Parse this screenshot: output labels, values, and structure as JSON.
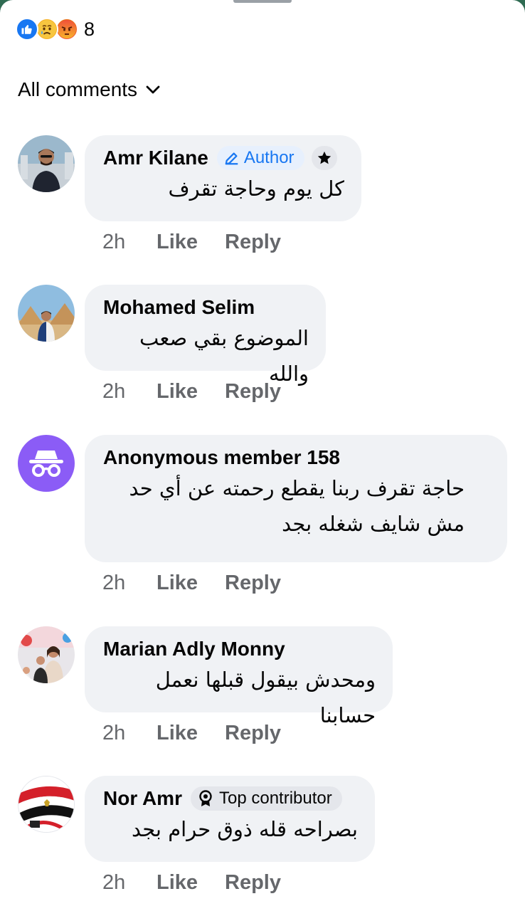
{
  "reactions": {
    "types": [
      "like",
      "sad",
      "angry"
    ],
    "count": "8"
  },
  "filter": {
    "label": "All comments"
  },
  "comments": [
    {
      "name": "Amr Kilane",
      "badge": "Author",
      "badge_type": "author",
      "has_star": true,
      "text": "كل يوم وحاجة تقرف",
      "time": "2h",
      "like": "Like",
      "reply": "Reply"
    },
    {
      "name": "Mohamed Selim",
      "badge": "",
      "text": "الموضوع بقي صعب والله",
      "time": "2h",
      "like": "Like",
      "reply": "Reply"
    },
    {
      "name": "Anonymous member 158",
      "badge": "",
      "text": "حاجة تقرف ربنا يقطع رحمته عن أي حد مش شايف شغله بجد",
      "time": "2h",
      "like": "Like",
      "reply": "Reply"
    },
    {
      "name": "Marian Adly Monny",
      "badge": "",
      "text": "ومحدش بيقول قبلها نعمل حسابنا",
      "time": "2h",
      "like": "Like",
      "reply": "Reply"
    },
    {
      "name": "Nor Amr",
      "badge": "Top contributor",
      "badge_type": "top-contributor",
      "text": "بصراحه قله ذوق حرام بجد",
      "time": "2h",
      "like": "Like",
      "reply": "Reply"
    }
  ],
  "colors": {
    "bubble": "#f0f2f5",
    "secondary_text": "#65676b",
    "accent": "#1877f2",
    "anonymous_avatar": "#8b5cf6"
  }
}
